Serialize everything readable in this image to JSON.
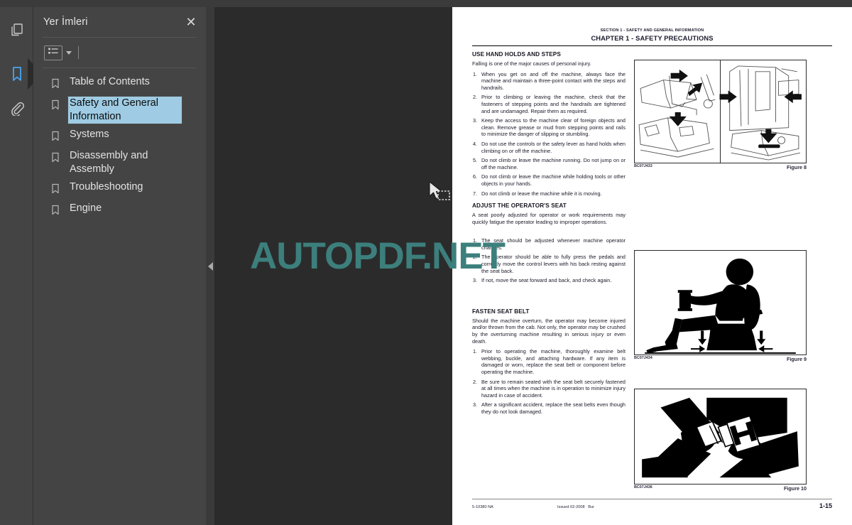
{
  "app": {
    "watermark": "AUTOPDF.NET",
    "watermark_color": "#3c7f7c",
    "accent_color": "#4aa3f0",
    "selection_color": "#9fcce4"
  },
  "rail": {
    "items": [
      {
        "name": "pages-thumbnail-icon",
        "label": "Pages",
        "selected": false
      },
      {
        "name": "bookmarks-icon",
        "label": "Bookmarks",
        "selected": true
      },
      {
        "name": "attachments-icon",
        "label": "Attachments",
        "selected": false
      }
    ]
  },
  "panel": {
    "title": "Yer İmleri",
    "close_label": "✕",
    "toolbar": {
      "list_options_label": "",
      "caret_label": ""
    },
    "bookmarks": [
      {
        "label": "Table of Contents",
        "selected": false
      },
      {
        "label": "Safety and General Information",
        "selected": true
      },
      {
        "label": "Systems",
        "selected": false
      },
      {
        "label": "Disassembly and Assembly",
        "selected": false
      },
      {
        "label": "Troubleshooting",
        "selected": false
      },
      {
        "label": "Engine",
        "selected": false
      }
    ]
  },
  "document": {
    "header": {
      "section": "SECTION 1 - SAFETY AND GENERAL INFORMATION",
      "chapter": "CHAPTER 1 - SAFETY PRECAUTIONS"
    },
    "sections": [
      {
        "title": "USE HAND HOLDS AND STEPS",
        "lead": "Falling is one of the major causes of personal injury.",
        "steps": [
          "When you get on and off the machine, always face the machine and maintain a three-point contact with the steps and handrails.",
          "Prior to climbing or leaving the machine, check that the fasteners of stepping points and the handrails are tightened and are undamaged. Repair them as required.",
          "Keep the access to the machine clear of foreign objects and clean. Remove grease or mud from stepping points and rails to minimize the danger of slipping or stumbling.",
          "Do not use the controls or the safety lever as hand holds when climbing on or off the machine.",
          "Do not climb or leave the machine running. Do not jump on or off the machine.",
          "Do not climb or leave the machine while holding tools or other objects in your hands.",
          "Do not climb or leave the machine while it is moving."
        ]
      },
      {
        "title": "ADJUST THE OPERATOR'S SEAT",
        "lead": "A seat poorly adjusted for operator or work requirements may quickly fatigue the operator leading to improper operations.",
        "steps": [
          "The seat should be adjusted whenever machine operator changes.",
          "The operator should be able to fully press the pedals and correctly move the control levers with his back resting against the seat back.",
          "If not, move the seat forward and back, and check again."
        ]
      },
      {
        "title": "FASTEN SEAT BELT",
        "lead": "Should the machine overturn, the operator may become injured and/or thrown from the cab. Not only, the operator may be crushed by the overturning machine resulting in serious injury or even death.",
        "steps": [
          "Prior to operating the machine, thoroughly examine belt webbing, buckle, and attaching hardware. If any item is damaged or worn, replace the seat belt or component before operating the machine.",
          "Be sure to remain seated with the seat belt securely fastened at all times when the machine is in operation to minimize injury hazard in case of accident.",
          "After a significant accident, replace the seat belts even though they do not look damaged."
        ]
      }
    ],
    "figures": [
      {
        "code": "BC07J433",
        "caption": "Figure 8"
      },
      {
        "code": "BC07J434",
        "caption": "Figure 9"
      },
      {
        "code": "BC07J436",
        "caption": "Figure 10"
      }
    ],
    "footer": {
      "doc_code": "5-10380 NA",
      "issued": "Issued 02-2008",
      "author": "Bur",
      "page_number": "1-15"
    }
  }
}
